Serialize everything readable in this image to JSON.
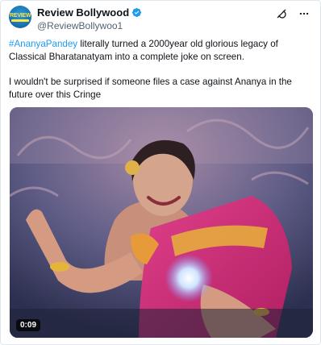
{
  "author": {
    "display_name": "Review Bollywood",
    "handle": "@ReviewBollywoo1",
    "avatar_text": "REVIEW",
    "verified_icon": "verified-badge-icon"
  },
  "header_icons": [
    "grok-icon",
    "more-icon"
  ],
  "tweet": {
    "hashtag": "#AnanyaPandey",
    "line1_rest": " literally turned a 2000year old glorious legacy of Classical Bharatanatyam into a complete joke on screen.",
    "line2": "I wouldn't be surprised if someone files a case against Ananya in the future over this Cringe"
  },
  "media": {
    "type": "video",
    "duration": "0:09"
  },
  "colors": {
    "text": "#0f1419",
    "secondary": "#536471",
    "link": "#1d9bf0",
    "verified": "#1d9bf0"
  }
}
